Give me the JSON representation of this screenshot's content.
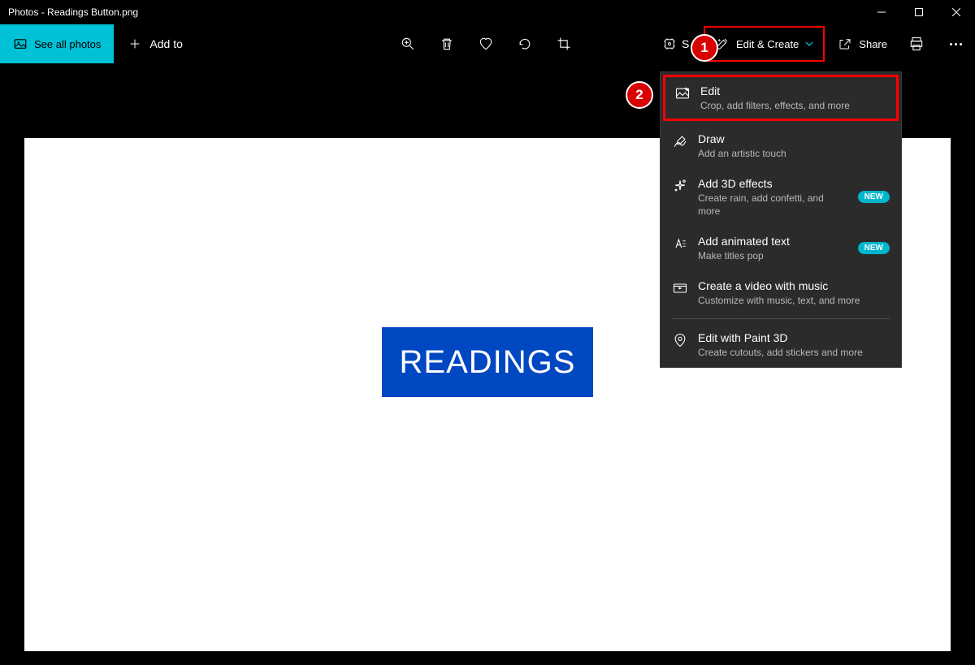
{
  "window": {
    "title": "Photos - Readings Button.png"
  },
  "toolbar": {
    "see_all": "See all photos",
    "add_to": "Add to",
    "spot_fix_partial": "S",
    "edit_create": "Edit & Create",
    "share": "Share"
  },
  "dropdown": {
    "items": [
      {
        "title": "Edit",
        "sub": "Crop, add filters, effects, and more",
        "badge": "",
        "highlight": true
      },
      {
        "title": "Draw",
        "sub": "Add an artistic touch",
        "badge": ""
      },
      {
        "title": "Add 3D effects",
        "sub": "Create rain, add confetti, and more",
        "badge": "NEW"
      },
      {
        "title": "Add animated text",
        "sub": "Make titles pop",
        "badge": "NEW"
      },
      {
        "title": "Create a video with music",
        "sub": "Customize with music, text, and more",
        "badge": ""
      },
      {
        "title": "Edit with Paint 3D",
        "sub": "Create cutouts, add stickers and more",
        "badge": ""
      }
    ]
  },
  "image": {
    "label": "READINGS"
  },
  "callouts": {
    "c1": "1",
    "c2": "2"
  }
}
